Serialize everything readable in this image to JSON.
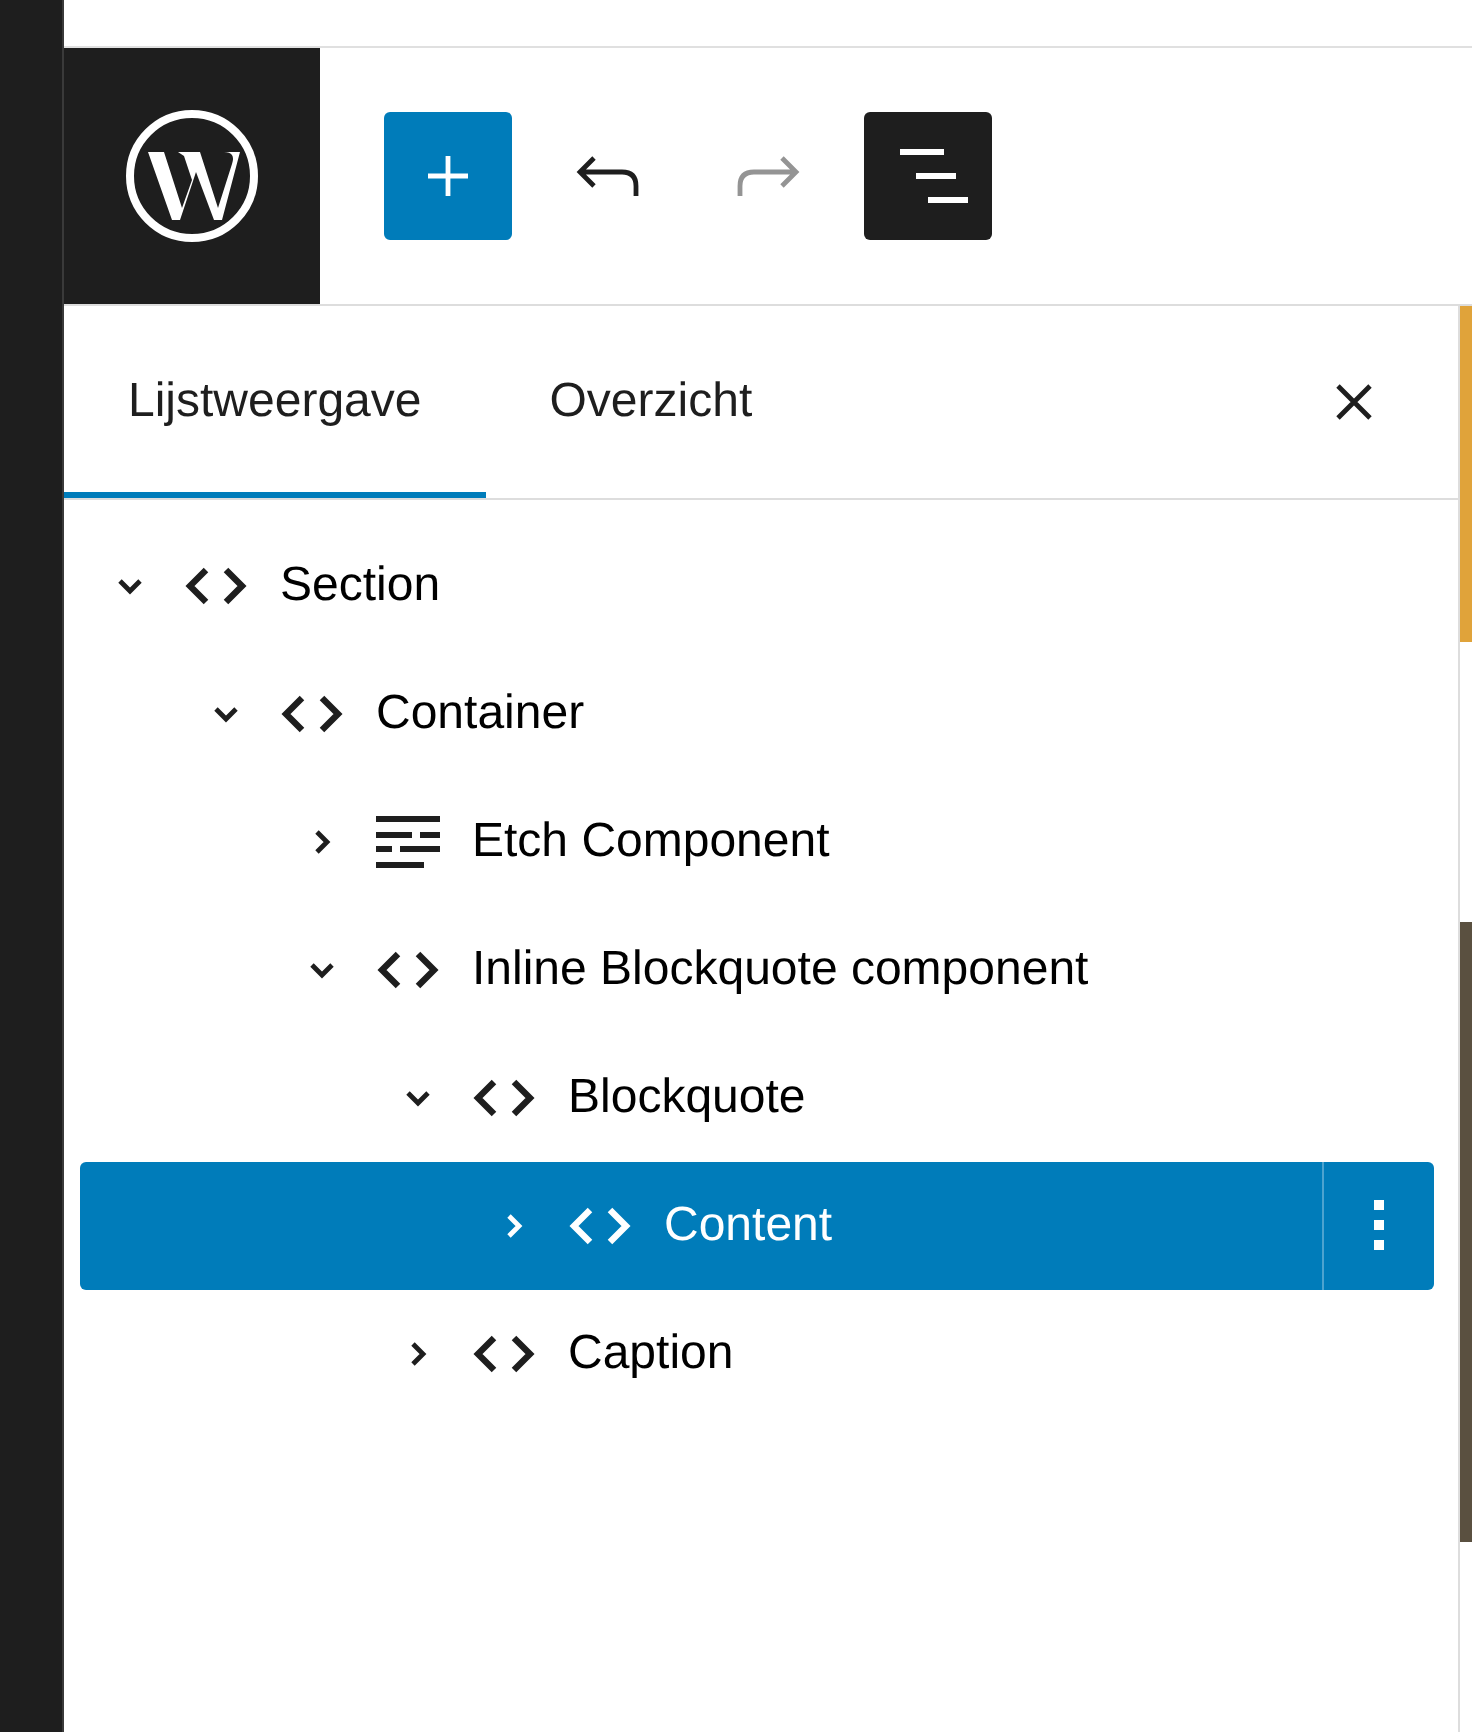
{
  "toolbar": {
    "undo_disabled": false,
    "redo_disabled": true,
    "list_view_open": true
  },
  "tabs": [
    {
      "label": "Lijstweergave",
      "selected": true
    },
    {
      "label": "Overzicht",
      "selected": false
    }
  ],
  "tree": [
    {
      "label": "Section",
      "kind": "element",
      "expanded": true,
      "selected": false,
      "children": [
        {
          "label": "Container",
          "kind": "element",
          "expanded": true,
          "selected": false,
          "children": [
            {
              "label": "Etch Component",
              "kind": "component",
              "expanded": false,
              "selected": false
            },
            {
              "label": "Inline Blockquote component",
              "kind": "element",
              "expanded": true,
              "selected": false,
              "children": [
                {
                  "label": "Blockquote",
                  "kind": "element",
                  "expanded": true,
                  "selected": false,
                  "children": [
                    {
                      "label": "Content",
                      "kind": "element",
                      "expanded": false,
                      "selected": true
                    }
                  ]
                },
                {
                  "label": "Caption",
                  "kind": "element",
                  "expanded": false,
                  "selected": false
                }
              ]
            }
          ]
        }
      ]
    }
  ]
}
